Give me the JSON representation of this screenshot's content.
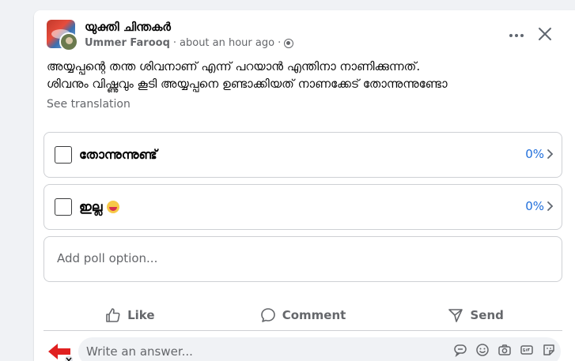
{
  "post": {
    "group_name": "യുക്തി ചിന്തകർ",
    "author": "Ummer Farooq",
    "separator": "·",
    "time": "about an hour ago",
    "text_line1": "അയ്യപ്പന്റെ തന്ത ശിവനാണ് എന്ന് പറയാൻ എന്തിനാ നാണിക്കുന്നത്.",
    "text_line2": "ശിവനും വിഷ്ണുവും കൂടി അയ്യപ്പനെ ഉണ്ടാക്കിയത് നാണക്കേട് തോന്നുന്നുണ്ടോ",
    "see_translation": "See translation"
  },
  "poll": {
    "options": [
      {
        "label": "തോന്നുന്നുണ്ട്",
        "percent": "0%",
        "emoji": ""
      },
      {
        "label": "ഇല്ല",
        "percent": "0%",
        "emoji": "laughing-emoji"
      }
    ],
    "add_placeholder": "Add poll option..."
  },
  "actions": {
    "like": "Like",
    "comment": "Comment",
    "send": "Send"
  },
  "answer": {
    "placeholder": "Write an answer..."
  },
  "colors": {
    "percent": "#216fdb",
    "border": "#ced0d4",
    "muted": "#65676b",
    "background": "#f0f2f5"
  },
  "icons": [
    "globe-icon",
    "more-options-icon",
    "close-icon",
    "chevron-right-icon",
    "like-icon",
    "comment-icon",
    "send-icon",
    "avatar-icon",
    "chat-bubble-icon",
    "emoji-icon",
    "camera-icon",
    "gif-icon",
    "sticker-icon"
  ]
}
